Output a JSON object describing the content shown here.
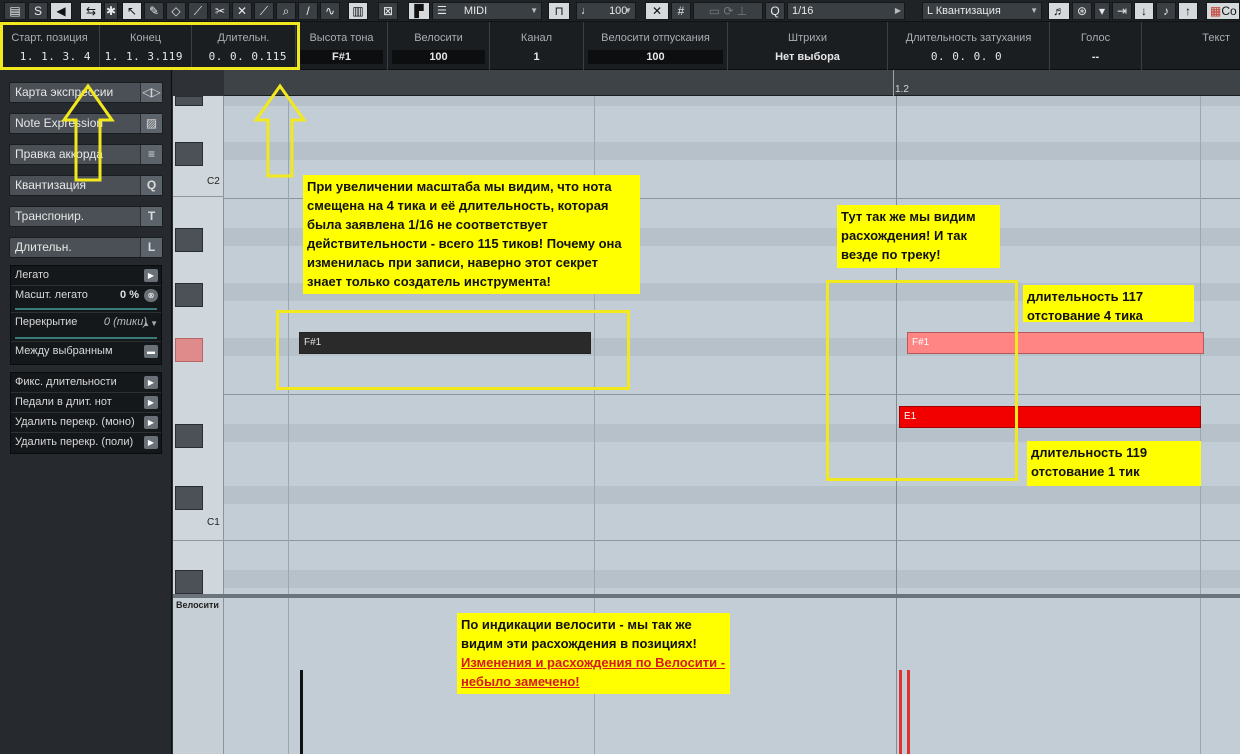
{
  "toolbar": {
    "midi_label": "MIDI",
    "velocity_value": "100",
    "quantize_value": "1/16",
    "quantize_preset": "Квантизация",
    "cut_label": "Co"
  },
  "info_line": {
    "columns": [
      {
        "label": "Старт. позиция",
        "value": "1. 1. 3.   4"
      },
      {
        "label": "Конец",
        "value": "1. 1. 3.119"
      },
      {
        "label": "Длительн.",
        "value": "0. 0. 0.115"
      },
      {
        "label": "Высота тона",
        "value": "F#1"
      },
      {
        "label": "Велосити",
        "value": "100"
      },
      {
        "label": "Канал",
        "value": "1"
      },
      {
        "label": "Велосити отпускания",
        "value": "100"
      },
      {
        "label": "Штрихи",
        "value": "Нет выбора"
      },
      {
        "label": "Длительность затухания",
        "value": "0. 0. 0.   0"
      },
      {
        "label": "Голос",
        "value": "--"
      },
      {
        "label": "Текст",
        "value": ""
      }
    ]
  },
  "inspector": {
    "sections": [
      {
        "label": "Карта экспрессии",
        "icon": "◁▷"
      },
      {
        "label": "Note Expression",
        "icon": "▨"
      },
      {
        "label": "Правка аккорда",
        "icon": "≡"
      },
      {
        "label": "Квантизация",
        "icon": "Q"
      },
      {
        "label": "Транспонир.",
        "icon": "T"
      },
      {
        "label": "Длительн.",
        "icon": "L"
      }
    ],
    "length_rows": [
      {
        "label": "Легато",
        "value": ""
      },
      {
        "label": "Масшт. легато",
        "value": "0 %"
      },
      {
        "label": "Перекрытие",
        "value": "0 (тики)"
      },
      {
        "label": "Между выбранным",
        "value": ""
      }
    ],
    "fixed_rows": [
      {
        "label": "Фикс. длительности"
      },
      {
        "label": "Педали в длит. нот"
      },
      {
        "label": "Удалить перекр. (моно)"
      },
      {
        "label": "Удалить перекр. (поли)"
      }
    ]
  },
  "keyboard": {
    "octave_labels": [
      "C2",
      "C1"
    ],
    "velocity_label": "Велосити"
  },
  "ruler": {
    "marker": "1.2"
  },
  "notes": [
    {
      "name": "F#1",
      "state": "selected",
      "color": "#2a2a2a"
    },
    {
      "name": "F#1",
      "state": "normal",
      "color": "#ff8585"
    },
    {
      "name": "E1",
      "state": "normal",
      "color": "#f20000"
    }
  ],
  "velocity_bars": [
    {
      "color": "#111111"
    },
    {
      "color": "#e03030"
    },
    {
      "color": "#e03030"
    }
  ],
  "annotations": {
    "zoom_note": "При увеличении масштаба мы видим, что нота смещена на 4 тика и её длительность, которая была заявлена 1/16 не соответствует действительности - всего 115 тиков! Почему она изменилась при записи, наверно этот секрет знает только  создатель инструмента!",
    "same_here": "Тут так же мы видим расхождения! И так везде по треку!",
    "len117_line1": "длительность 117",
    "len117_line2": "отстование 4 тика",
    "len119_line1": "длительность 119",
    "len119_line2": "отстование 1 тик",
    "velocity_note": "По индикации велосити - мы так же видим эти расхождения в позициях!",
    "velocity_note_red": "Изменения и расхождения по Велосити - небыло замечено!"
  },
  "colors": {
    "highlight": "#ffff00",
    "frame": "#f2e81e"
  }
}
